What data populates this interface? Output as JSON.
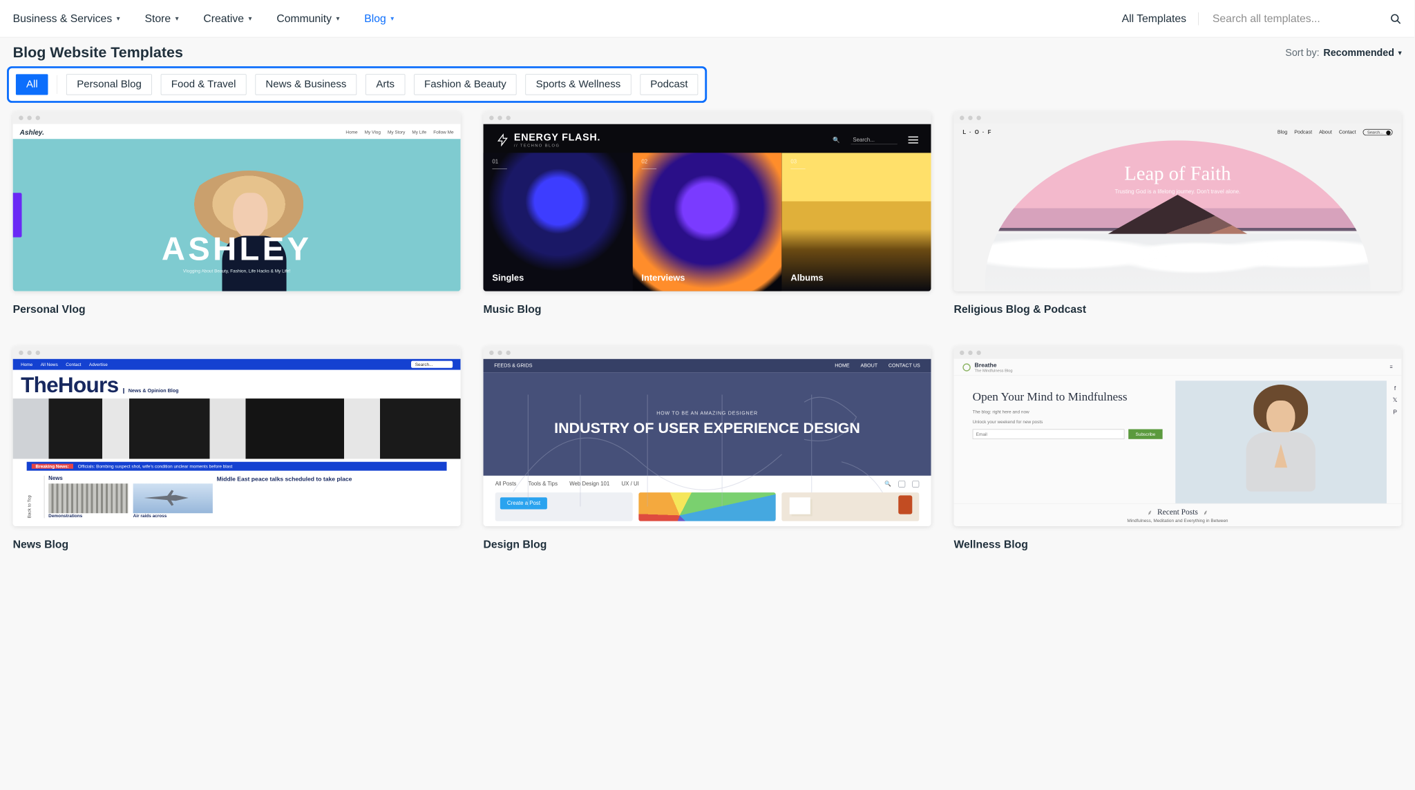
{
  "nav": {
    "items": [
      {
        "label": "Business & Services"
      },
      {
        "label": "Store"
      },
      {
        "label": "Creative"
      },
      {
        "label": "Community"
      },
      {
        "label": "Blog",
        "active": true
      }
    ],
    "all_templates": "All Templates",
    "search_placeholder": "Search all templates..."
  },
  "page_title": "Blog Website Templates",
  "sort": {
    "label": "Sort by:",
    "value": "Recommended"
  },
  "filters": [
    "All",
    "Personal Blog",
    "Food & Travel",
    "News & Business",
    "Arts",
    "Fashion & Beauty",
    "Sports & Wellness",
    "Podcast"
  ],
  "filter_selected": "All",
  "templates": [
    {
      "title": "Personal Vlog",
      "preview": {
        "brand": "Ashley.",
        "menu": [
          "Home",
          "My Vlog",
          "My Story",
          "My Life",
          "Follow Me"
        ],
        "hero_title": "ASHLEY",
        "hero_tagline": "Vlogging About Beauty, Fashion, Life Hacks & My Life!"
      }
    },
    {
      "title": "Music Blog",
      "preview": {
        "logo_name": "ENERGY FLASH.",
        "logo_sub": "// TECHNO BLOG",
        "search_label": "Search...",
        "columns": [
          {
            "index": "01",
            "label": "Singles"
          },
          {
            "index": "02",
            "label": "Interviews"
          },
          {
            "index": "03",
            "label": "Albums"
          }
        ]
      }
    },
    {
      "title": "Religious Blog & Podcast",
      "preview": {
        "brand": "L · O · F",
        "nav": [
          "Blog",
          "Podcast",
          "About",
          "Contact"
        ],
        "search": "Search...",
        "title": "Leap of Faith",
        "subtitle": "Trusting God is a lifelong journey. Don't travel alone."
      }
    },
    {
      "title": "News Blog",
      "preview": {
        "nav": [
          "Home",
          "All News",
          "Contact",
          "Advertise"
        ],
        "search": "Search...",
        "masthead": "TheHours",
        "mast_sub": "News & Opinion Blog",
        "ticker_label": "Breaking News:",
        "ticker_text": "Officials: Bombing suspect shot, wife's condition unclear moments before blast",
        "section": "News",
        "headline": "Middle East peace talks scheduled to take place",
        "caption_left": "Demonstrations",
        "caption_right": "Air raids across",
        "sidebar": "Back to Top"
      }
    },
    {
      "title": "Design Blog",
      "preview": {
        "brand": "FEEDS & GRIDS",
        "nav": [
          "HOME",
          "ABOUT",
          "CONTACT US"
        ],
        "kicker": "HOW TO BE AN AMAZING DESIGNER",
        "hero": "INDUSTRY OF USER EXPERIENCE DESIGN",
        "tabs": [
          "All Posts",
          "Tools & Tips",
          "Web Design 101",
          "UX / UI"
        ],
        "cta": "Create a Post"
      }
    },
    {
      "title": "Wellness Blog",
      "preview": {
        "brand": "Breathe",
        "brand_sub": "The Mindfulness Blog",
        "hero_title": "Open Your Mind to Mindfulness",
        "hero_sub": "The blog: right here and now",
        "hero_sub2": "Unlock your weekend for new posts",
        "email_placeholder": "Email",
        "subscribe": "Subscribe",
        "recent_title": "Recent Posts",
        "recent_sub": "Mindfulness, Meditation and Everything in Between"
      }
    }
  ]
}
